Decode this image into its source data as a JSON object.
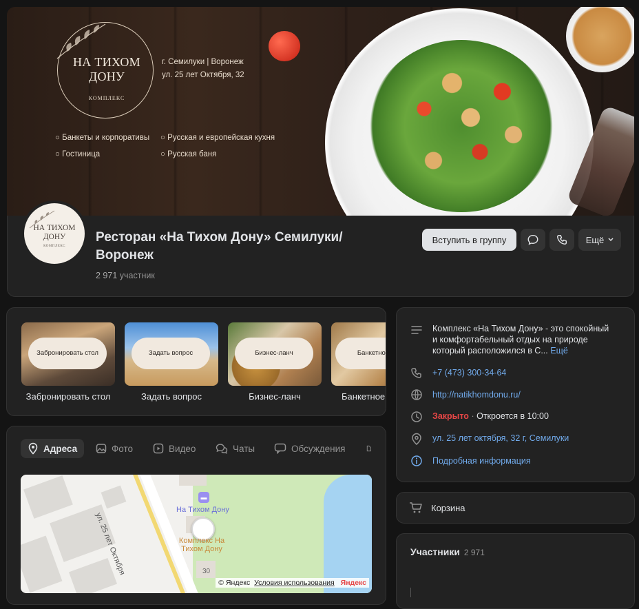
{
  "cover": {
    "logo_name": "НА ТИХОМ ДОНУ",
    "logo_sub": "КОМПЛЕКС",
    "city": "г. Семилуки | Воронеж",
    "street": "ул. 25 лет Октября, 32",
    "features": [
      "Банкеты и корпоративы",
      "Русская и европейская кухня",
      "Гостиница",
      "Русская баня"
    ]
  },
  "header": {
    "title_line1": "Ресторан «На Тихом Дону» Семилуки/",
    "title_line2": "Воронеж",
    "members_count": "2 971",
    "members_label": "участник",
    "join_label": "Вступить в группу",
    "more_label": "Ещё",
    "avatar_text": "НА ТИХОМ ДОНУ",
    "avatar_sub": "КОМПЛЕКС"
  },
  "actions": [
    {
      "pill": "Забронировать стол",
      "label": "Забронировать стол"
    },
    {
      "pill": "Задать вопрос",
      "label": "Задать вопрос"
    },
    {
      "pill": "Бизнес-ланч",
      "label": "Бизнес-ланч"
    },
    {
      "pill": "Банкетное",
      "label": "Банкетное"
    }
  ],
  "tabs": [
    "Адреса",
    "Фото",
    "Видео",
    "Чаты",
    "Обсуждения"
  ],
  "map": {
    "street_label": "ул. 25 лет Октября",
    "place1": "На Тихом Дону",
    "place2_line1": "Комплекс На",
    "place2_line2": "Тихом Дону",
    "house_number": "30",
    "copyright": "© Яндекс",
    "terms": "Условия использования",
    "brand": "Яндекс"
  },
  "info": {
    "description": "Комплекс «На Тихом Дону» - это спокойный и комфортабельный отдых на природе который расположился в С...",
    "description_line1": "Комплекс «На Тихом Дону» - это спокойный",
    "description_line2": "и комфортабельный отдых на природе",
    "description_line3": "который расположился в С...",
    "more_link": "Ещё",
    "phone": "+7 (473) 300-34-64",
    "website": "http://natikhomdonu.ru/",
    "status": "Закрыто",
    "status_separator": "·",
    "opens": "Откроется в 10:00",
    "address": "ул. 25 лет октября, 32 г, Семилуки",
    "details": "Подробная информация"
  },
  "cart": {
    "label": "Корзина"
  },
  "members": {
    "title": "Участники",
    "count": "2 971"
  },
  "colors": {
    "bg": "#141414",
    "card": "#222222",
    "accent": "#71aaeb",
    "closed": "#e64646"
  }
}
